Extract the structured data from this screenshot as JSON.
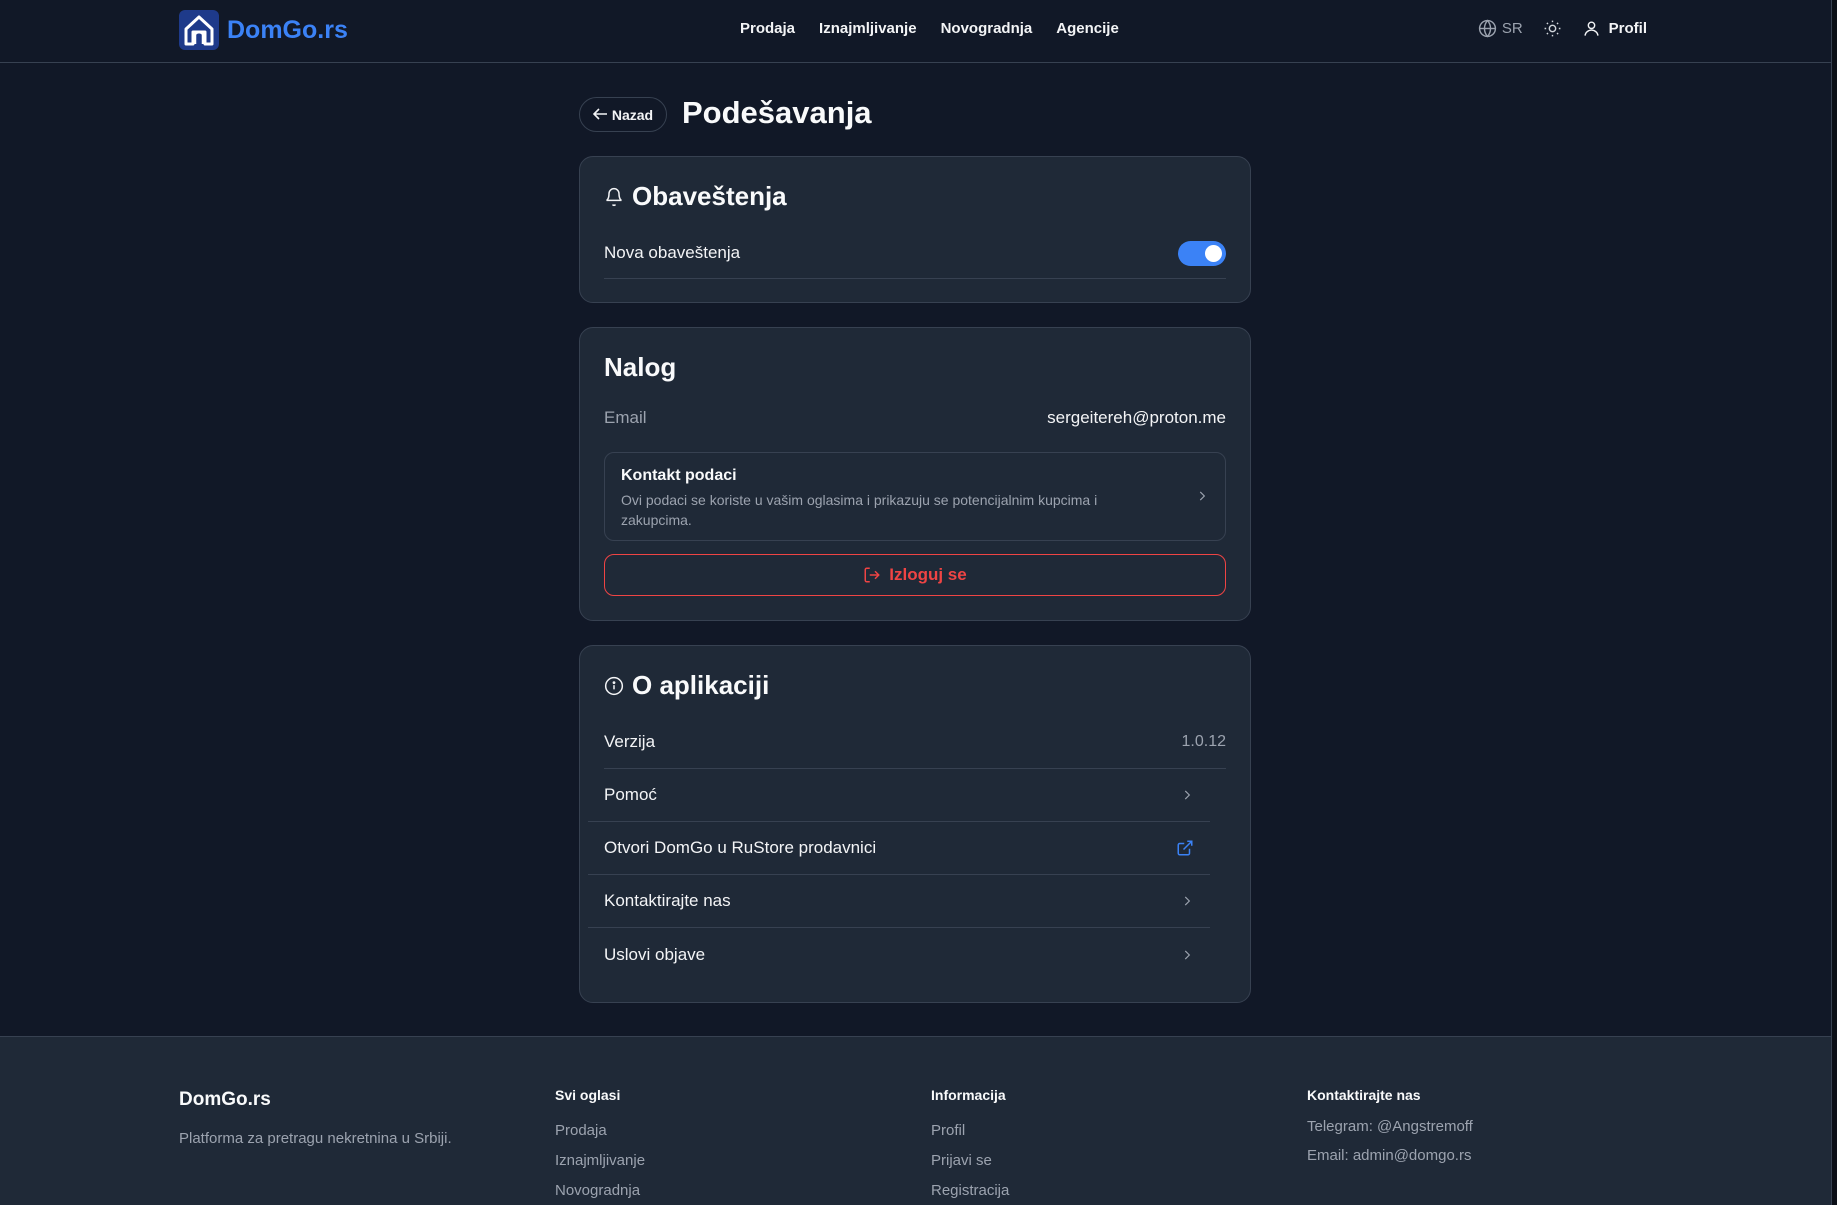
{
  "header": {
    "logo_text": "DomGo.rs",
    "nav": [
      "Prodaja",
      "Iznajmljivanje",
      "Novogradnja",
      "Agencije"
    ],
    "language": "SR",
    "profile_label": "Profil"
  },
  "page": {
    "back_label": "Nazad",
    "title": "Podešavanja"
  },
  "notifications": {
    "title": "Obaveštenja",
    "toggle_label": "Nova obaveštenja",
    "toggle_on": true,
    "accent": "#3b82f6"
  },
  "account": {
    "title": "Nalog",
    "email_label": "Email",
    "email_value": "sergeitereh@proton.me",
    "contact_title": "Kontakt podaci",
    "contact_desc": "Ovi podaci se koriste u vašim oglasima i prikazuju se potencijalnim kupcima i zakupcima.",
    "logout_label": "Izloguj se",
    "logout_color": "#ef4444"
  },
  "about": {
    "title": "O aplikaciji",
    "version_label": "Verzija",
    "version_value": "1.0.12",
    "help_label": "Pomoć",
    "store_label": "Otvori DomGo u RuStore prodavnici",
    "contact_label": "Kontaktirajte nas",
    "terms_label": "Uslovi objave"
  },
  "footer": {
    "brand": "DomGo.rs",
    "tagline": "Platforma za pretragu nekretnina u Srbiji.",
    "col1_title": "Svi oglasi",
    "col1_links": [
      "Prodaja",
      "Iznajmljivanje",
      "Novogradnja"
    ],
    "col2_title": "Informacija",
    "col2_links": [
      "Profil",
      "Prijavi se",
      "Registracija"
    ],
    "col3_title": "Kontaktirajte nas",
    "telegram": "Telegram: @Angstremoff",
    "email": "Email: admin@domgo.rs"
  }
}
